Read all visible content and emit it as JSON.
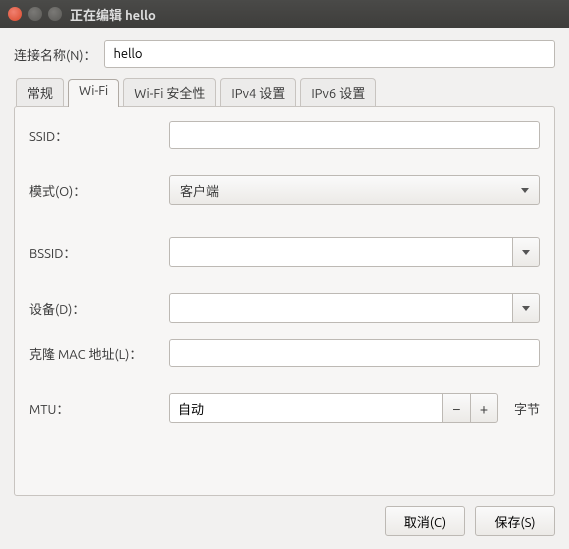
{
  "window": {
    "title": "正在编辑 hello"
  },
  "connection_name": {
    "label": "连接名称(N)：",
    "value": "hello"
  },
  "tabs": {
    "general": "常规",
    "wifi": "Wi-Fi",
    "wifi_security": "Wi-Fi 安全性",
    "ipv4": "IPv4 设置",
    "ipv6": "IPv6 设置",
    "active": "wifi"
  },
  "wifi_panel": {
    "ssid": {
      "label": "SSID：",
      "value": ""
    },
    "mode": {
      "label": "模式(O)：",
      "value": "客户端"
    },
    "bssid": {
      "label": "BSSID：",
      "value": ""
    },
    "device": {
      "label": "设备(D)：",
      "value": ""
    },
    "clone_mac": {
      "label": "克隆 MAC 地址(L)：",
      "value": ""
    },
    "mtu": {
      "label": "MTU：",
      "value": "自动",
      "unit": "字节"
    }
  },
  "buttons": {
    "cancel": "取消(C)",
    "save": "保存(S)"
  },
  "colors": {
    "window_bg": "#f2f1f0",
    "titlebar_start": "#4a4a48",
    "close_accent": "#d9492b"
  }
}
